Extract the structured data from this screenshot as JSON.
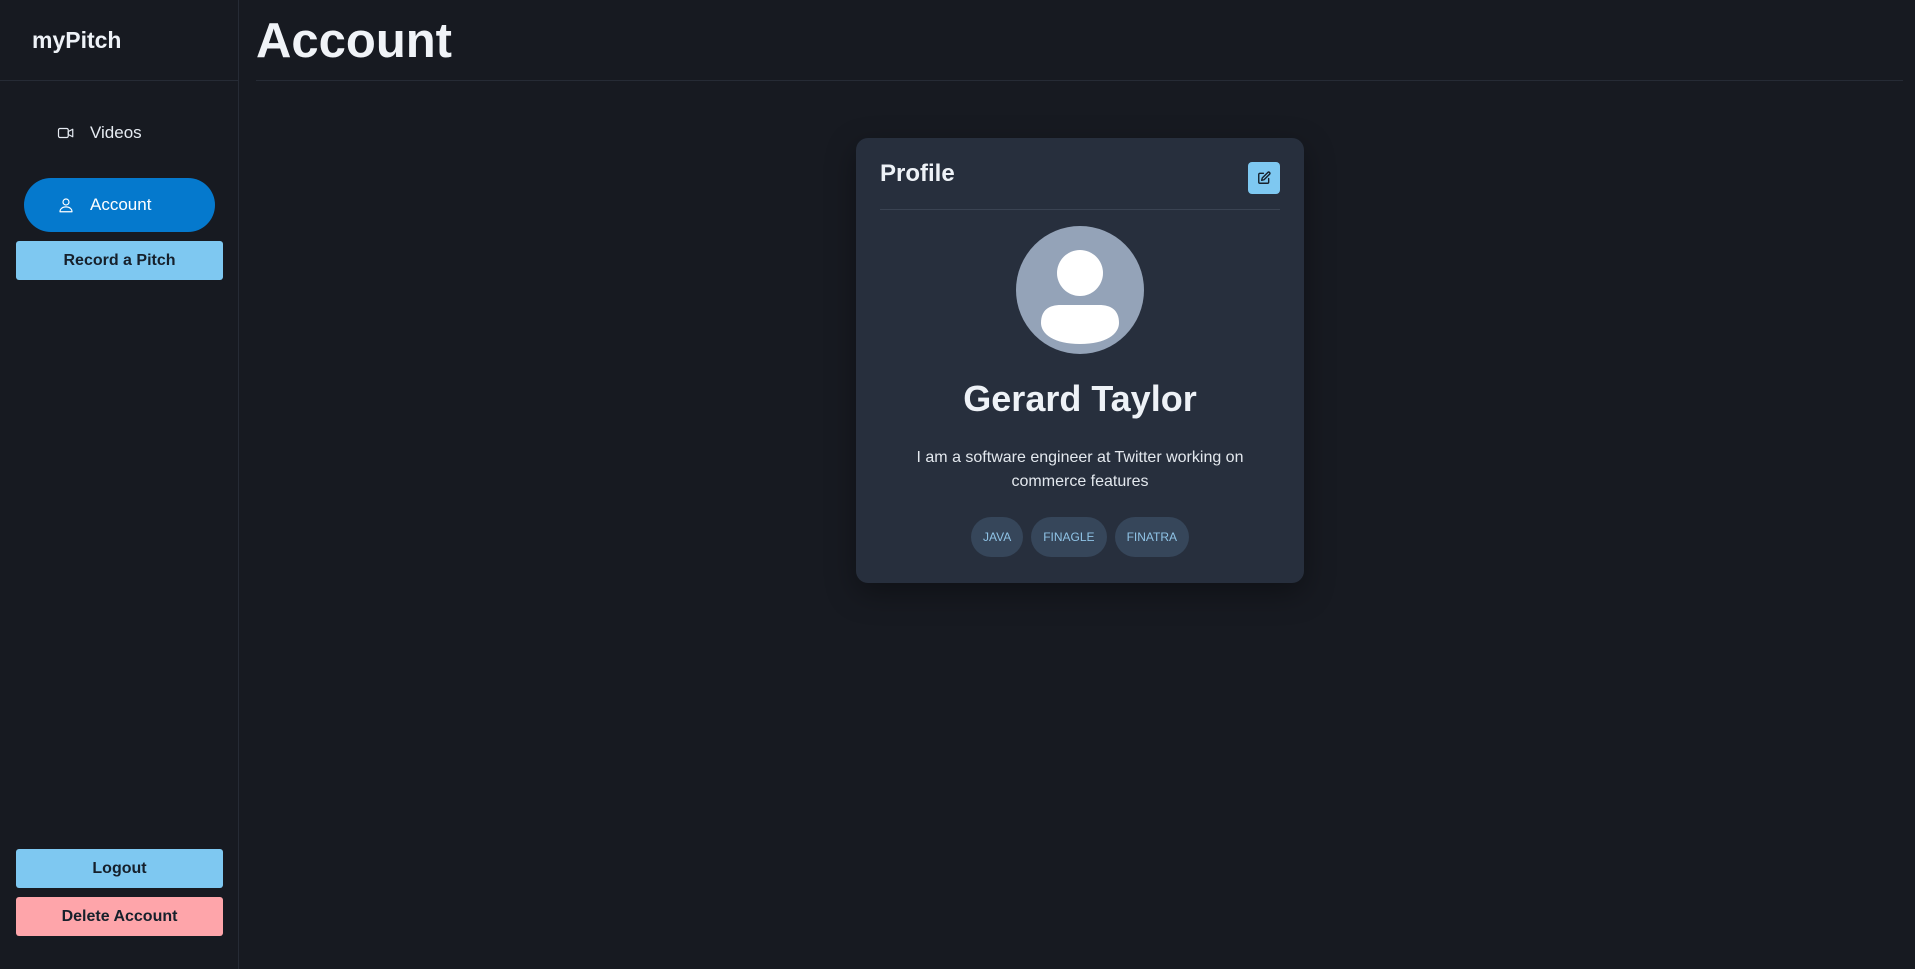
{
  "brand": "myPitch",
  "sidebar": {
    "items": [
      {
        "label": "Videos",
        "icon": "video-camera-icon"
      },
      {
        "label": "Account",
        "icon": "user-icon",
        "active": true
      }
    ],
    "record_label": "Record a Pitch",
    "logout_label": "Logout",
    "delete_label": "Delete Account"
  },
  "main": {
    "title": "Account"
  },
  "profile": {
    "card_title": "Profile",
    "edit_icon": "edit-icon",
    "name": "Gerard Taylor",
    "bio": "I am a software engineer at Twitter working on commerce features",
    "tags": [
      "JAVA",
      "FINAGLE",
      "FINATRA"
    ]
  },
  "colors": {
    "background": "#171a21",
    "accent": "#0579cd",
    "button_blue": "#7ec8f1",
    "button_red": "#fea5aa",
    "card": "#272f3d"
  }
}
